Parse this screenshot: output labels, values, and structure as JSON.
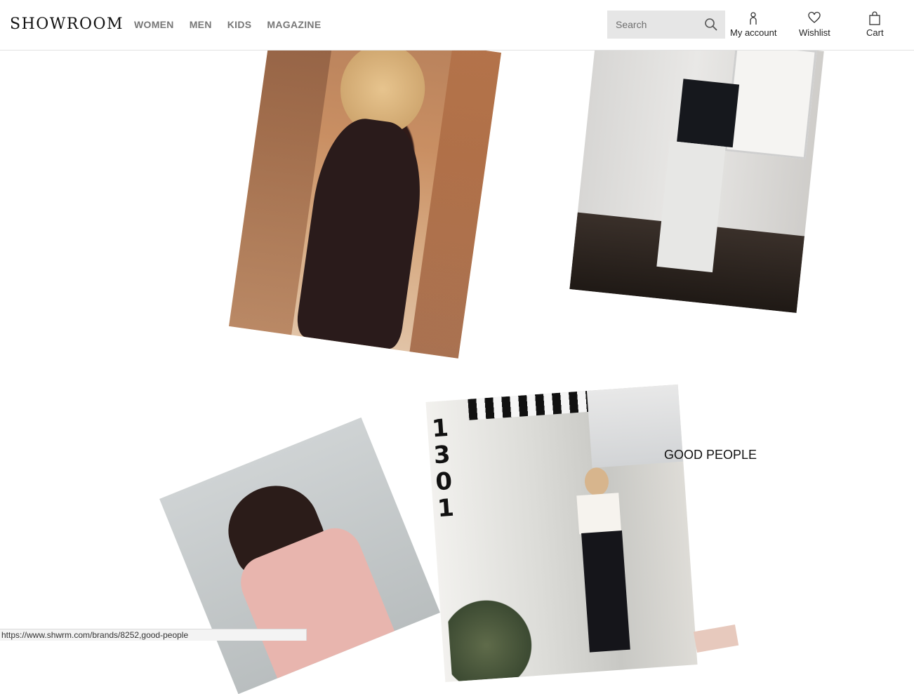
{
  "header": {
    "logo": "SHOWROOM",
    "nav": [
      "WOMEN",
      "MEN",
      "KIDS",
      "MAGAZINE"
    ],
    "search": {
      "placeholder": "Search",
      "value": ""
    },
    "account_label": "My account",
    "wishlist_label": "Wishlist",
    "cart_label": "Cart"
  },
  "collage": {
    "brand_label": "GOOD PEOPLE",
    "storefront_number": "1\n3\n0\n1"
  },
  "status_bar": {
    "url": "https://www.shwrm.com/brands/8252,good-people"
  },
  "colors": {
    "nav_text": "#777777",
    "search_bg": "#e6e6e6",
    "header_border": "#e2e2e2"
  },
  "icons": {
    "search": "search-icon",
    "account": "user-icon",
    "wishlist": "heart-icon",
    "cart": "shopping-bag-icon"
  }
}
